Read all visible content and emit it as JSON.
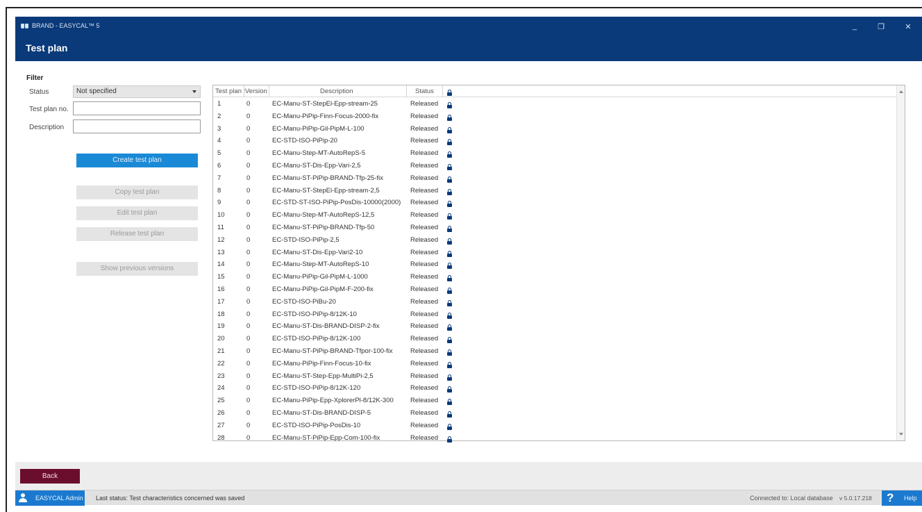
{
  "window": {
    "app_title": "BRAND - EASYCAL™ 5",
    "page_title": "Test plan",
    "minimize": "_",
    "restore": "❐",
    "close": "✕"
  },
  "filter": {
    "title": "Filter",
    "status_label": "Status",
    "status_value": "Not specified",
    "testplan_label": "Test plan no.",
    "testplan_value": "",
    "description_label": "Description",
    "description_value": ""
  },
  "actions": {
    "create": "Create test plan",
    "copy": "Copy test plan",
    "edit": "Edit test plan",
    "release": "Release test plan",
    "previous": "Show previous versions"
  },
  "table": {
    "headers": {
      "no": "Test plan no.",
      "version": "Version",
      "description": "Description",
      "status": "Status"
    },
    "rows": [
      {
        "no": "1",
        "version": "0",
        "description": "EC-Manu-ST-StepEl-Epp-stream-25",
        "status": "Released"
      },
      {
        "no": "2",
        "version": "0",
        "description": "EC-Manu-PiPip-Finn-Focus-2000-fix",
        "status": "Released"
      },
      {
        "no": "3",
        "version": "0",
        "description": "EC-Manu-PiPip-Gil-PipM-L-100",
        "status": "Released"
      },
      {
        "no": "4",
        "version": "0",
        "description": "EC-STD-ISO-PiPip-20",
        "status": "Released"
      },
      {
        "no": "5",
        "version": "0",
        "description": "EC-Manu-Step-MT-AutoRepS-5",
        "status": "Released"
      },
      {
        "no": "6",
        "version": "0",
        "description": "EC-Manu-ST-Dis-Epp-Vari-2,5",
        "status": "Released"
      },
      {
        "no": "7",
        "version": "0",
        "description": "EC-Manu-ST-PiPip-BRAND-Tfp-25-fix",
        "status": "Released"
      },
      {
        "no": "8",
        "version": "0",
        "description": "EC-Manu-ST-StepEl-Epp-stream-2,5",
        "status": "Released"
      },
      {
        "no": "9",
        "version": "0",
        "description": "EC-STD-ST-ISO-PiPip-PosDis-10000(2000)",
        "status": "Released"
      },
      {
        "no": "10",
        "version": "0",
        "description": "EC-Manu-Step-MT-AutoRepS-12,5",
        "status": "Released"
      },
      {
        "no": "11",
        "version": "0",
        "description": "EC-Manu-ST-PiPip-BRAND-Tfp-50",
        "status": "Released"
      },
      {
        "no": "12",
        "version": "0",
        "description": "EC-STD-ISO-PiPip-2,5",
        "status": "Released"
      },
      {
        "no": "13",
        "version": "0",
        "description": "EC-Manu-ST-Dis-Epp-Vari2-10",
        "status": "Released"
      },
      {
        "no": "14",
        "version": "0",
        "description": "EC-Manu-Step-MT-AutoRepS-10",
        "status": "Released"
      },
      {
        "no": "15",
        "version": "0",
        "description": "EC-Manu-PiPip-Gil-PipM-L-1000",
        "status": "Released"
      },
      {
        "no": "16",
        "version": "0",
        "description": "EC-Manu-PiPip-Gil-PipM-F-200-fix",
        "status": "Released"
      },
      {
        "no": "17",
        "version": "0",
        "description": "EC-STD-ISO-PiBu-20",
        "status": "Released"
      },
      {
        "no": "18",
        "version": "0",
        "description": "EC-STD-ISO-PiPip-8/12K-10",
        "status": "Released"
      },
      {
        "no": "19",
        "version": "0",
        "description": "EC-Manu-ST-Dis-BRAND-DISP-2-fix",
        "status": "Released"
      },
      {
        "no": "20",
        "version": "0",
        "description": "EC-STD-ISO-PiPip-8/12K-100",
        "status": "Released"
      },
      {
        "no": "21",
        "version": "0",
        "description": "EC-Manu-ST-PiPip-BRAND-Tfpor-100-fix",
        "status": "Released"
      },
      {
        "no": "22",
        "version": "0",
        "description": "EC-Manu-PiPip-Finn-Focus-10-fix",
        "status": "Released"
      },
      {
        "no": "23",
        "version": "0",
        "description": "EC-Manu-ST-Step-Epp-MultiPi-2,5",
        "status": "Released"
      },
      {
        "no": "24",
        "version": "0",
        "description": "EC-STD-ISO-PiPip-8/12K-120",
        "status": "Released"
      },
      {
        "no": "25",
        "version": "0",
        "description": "EC-Manu-PiPip-Epp-XplorerPl-8/12K-300",
        "status": "Released"
      },
      {
        "no": "26",
        "version": "0",
        "description": "EC-Manu-ST-Dis-BRAND-DISP-5",
        "status": "Released"
      },
      {
        "no": "27",
        "version": "0",
        "description": "EC-STD-ISO-PiPip-PosDis-10",
        "status": "Released"
      },
      {
        "no": "28",
        "version": "0",
        "description": "EC-Manu-ST-PiPip-Epp-Com-100-fix",
        "status": "Released"
      }
    ]
  },
  "footer": {
    "back": "Back",
    "user": "EASYCAL Admin",
    "last_status": "Last status: Test characteristics concerned was saved",
    "connection": "Connected to: Local database",
    "version": "v 5.0.17.218",
    "help_symbol": "?",
    "help": "Help"
  },
  "colors": {
    "titlebar": "#0a3a7a",
    "primary_button": "#1b8ad6",
    "back_button": "#6b0e2e",
    "user_chip": "#1b7ad0"
  }
}
